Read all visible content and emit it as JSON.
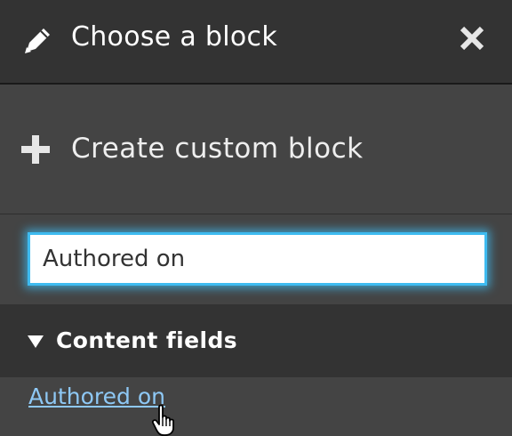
{
  "header": {
    "title": "Choose a block",
    "title_icon": "pencil-icon",
    "close_icon": "close-icon"
  },
  "create": {
    "label": "Create custom block",
    "icon": "plus-icon"
  },
  "search": {
    "value": "Authored on",
    "placeholder": ""
  },
  "category": {
    "label": "Content fields",
    "expanded": true,
    "icon": "triangle-down-icon"
  },
  "results": [
    {
      "label": "Authored on"
    }
  ],
  "colors": {
    "header_bg": "#333333",
    "panel_bg": "#444444",
    "focus_border": "#3ebbf0",
    "link": "#8ec8f5"
  }
}
